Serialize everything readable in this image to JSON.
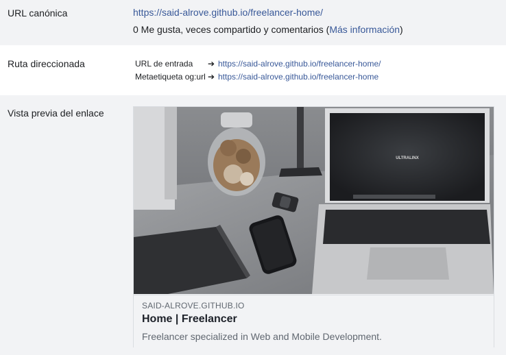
{
  "canonical": {
    "label": "URL canónica",
    "url": "https://said-alrove.github.io/freelancer-home/",
    "stats_prefix": "0 Me gusta, veces compartido y comentarios (",
    "more_info": "Más información",
    "stats_suffix": ")"
  },
  "redirect": {
    "label": "Ruta direccionada",
    "rows": [
      {
        "key": "URL de entrada",
        "arrow": "➔",
        "url": "https://said-alrove.github.io/freelancer-home/"
      },
      {
        "key": "Metaetiqueta og:url",
        "arrow": "➔",
        "url": "https://said-alrove.github.io/freelancer-home"
      }
    ]
  },
  "preview": {
    "label": "Vista previa del enlace",
    "image_brand_text": "ULTRALINX",
    "domain": "SAID-ALROVE.GITHUB.IO",
    "title": "Home | Freelancer",
    "description": "Freelancer specialized in Web and Mobile Development."
  }
}
